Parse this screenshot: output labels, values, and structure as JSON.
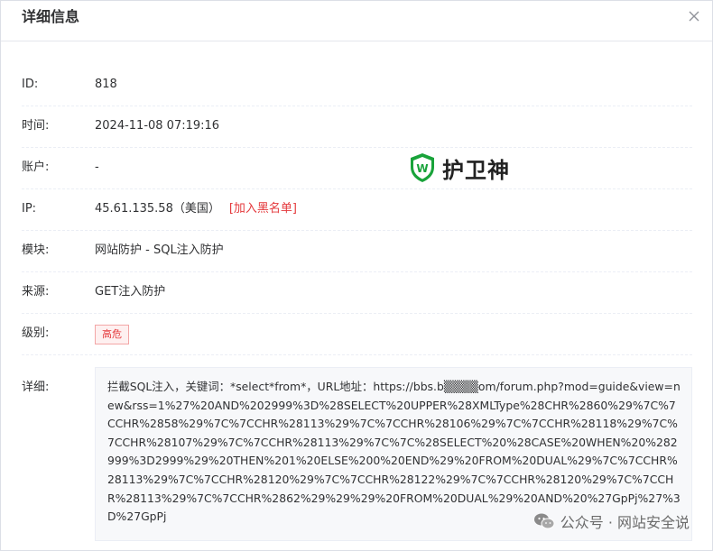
{
  "dialog": {
    "title": "详细信息"
  },
  "fields": {
    "id": {
      "label": "ID:",
      "value": "818"
    },
    "time": {
      "label": "时间:",
      "value": "2024-11-08 07:19:16"
    },
    "account": {
      "label": "账户:",
      "value": "-"
    },
    "ip": {
      "label": "IP:",
      "value": "45.61.135.58（美国）",
      "action": "[加入黑名单]"
    },
    "module": {
      "label": "模块:",
      "value": "网站防护 - SQL注入防护"
    },
    "source": {
      "label": "来源:",
      "value": "GET注入防护"
    },
    "level": {
      "label": "级别:",
      "value": "高危"
    },
    "detail": {
      "label": "详细:",
      "value": "拦截SQL注入，关键词：*select*from*，URL地址：https://bbs.b▒▒▒▒om/forum.php?mod=guide&view=new&rss=1%27%20AND%202999%3D%28SELECT%20UPPER%28XMLType%28CHR%2860%29%7C%7CCHR%2858%29%7C%7CCHR%28113%29%7C%7CCHR%28106%29%7C%7CCHR%28118%29%7C%7CCHR%28107%29%7C%7CCHR%28113%29%7C%7C%28SELECT%20%28CASE%20WHEN%20%282999%3D2999%29%20THEN%201%20ELSE%200%20END%29%20FROM%20DUAL%29%7C%7CCHR%28113%29%7C%7CCHR%28120%29%7C%7CCHR%28122%29%7C%7CCHR%28120%29%7C%7CCHR%28113%29%7C%7CCHR%2862%29%29%29%20FROM%20DUAL%29%20AND%20%27GpPj%27%3D%27GpPj"
    }
  },
  "watermark": {
    "brand": "护卫神",
    "logo_letter": "W"
  },
  "footer_watermark": {
    "text": "公众号 · 网站安全说"
  },
  "colors": {
    "danger": "#e4393c",
    "brand_green": "#19a33a"
  }
}
